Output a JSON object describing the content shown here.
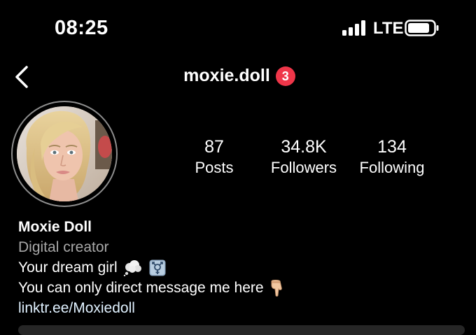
{
  "status_bar": {
    "time": "08:25",
    "network": "LTE"
  },
  "header": {
    "username": "moxie.doll",
    "notification_count": "3"
  },
  "stats": {
    "posts": {
      "value": "87",
      "label": "Posts"
    },
    "followers": {
      "value": "34.8K",
      "label": "Followers"
    },
    "following": {
      "value": "134",
      "label": "Following"
    }
  },
  "bio": {
    "name": "Moxie Doll",
    "category": "Digital creator",
    "line1": "Your dream girl",
    "line2": "You can only direct message me here",
    "link": "linktr.ee/Moxiedoll"
  },
  "colors": {
    "background": "#000000",
    "badge": "#ef3649",
    "secondary_text": "#a8a8a8",
    "link": "#e0f1ff"
  },
  "icons": [
    "signal-icon",
    "battery-icon",
    "back-icon",
    "thought-bubble-icon",
    "transgender-symbol-icon",
    "pointing-down-hand-icon"
  ]
}
